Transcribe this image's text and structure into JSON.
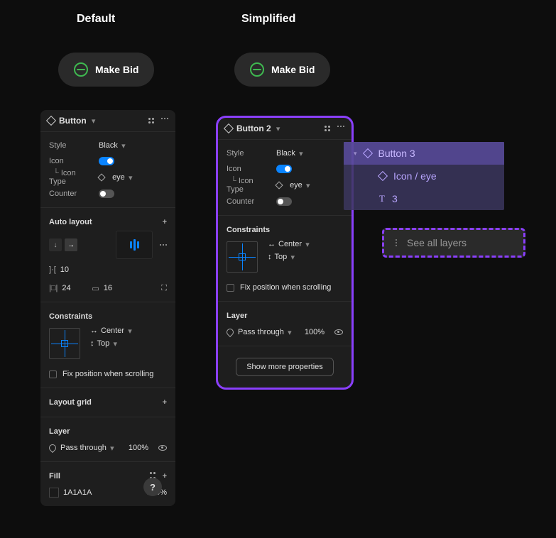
{
  "labels": {
    "default": "Default",
    "simplified": "Simplified"
  },
  "pill": {
    "text": "Make Bid"
  },
  "panel1": {
    "component_name": "Button",
    "style_label": "Style",
    "style_value": "Black",
    "icon_label": "Icon",
    "icon_type_label": "Icon Type",
    "icon_type_value": "eye",
    "counter_label": "Counter",
    "auto_layout_head": "Auto layout",
    "spacing_h": "10",
    "spacing_v": "24",
    "padding": "16",
    "constraints_head": "Constraints",
    "constraint_h": "Center",
    "constraint_v": "Top",
    "fix_pos": "Fix position when scrolling",
    "layout_grid_head": "Layout grid",
    "layer_head": "Layer",
    "blend_mode": "Pass through",
    "opacity": "100%",
    "fill_head": "Fill",
    "fill_hex": "1A1A1A",
    "fill_opacity": "100%"
  },
  "panel2": {
    "component_name": "Button 2",
    "style_label": "Style",
    "style_value": "Black",
    "icon_label": "Icon",
    "icon_type_label": "Icon Type",
    "icon_type_value": "eye",
    "counter_label": "Counter",
    "constraints_head": "Constraints",
    "constraint_h": "Center",
    "constraint_v": "Top",
    "fix_pos": "Fix position when scrolling",
    "layer_head": "Layer",
    "blend_mode": "Pass through",
    "opacity": "100%",
    "show_more": "Show more properties"
  },
  "layers": {
    "item1": "Button 3",
    "item2": "Icon / eye",
    "item3": "3",
    "see_all": "See all layers"
  },
  "chart_data": null
}
